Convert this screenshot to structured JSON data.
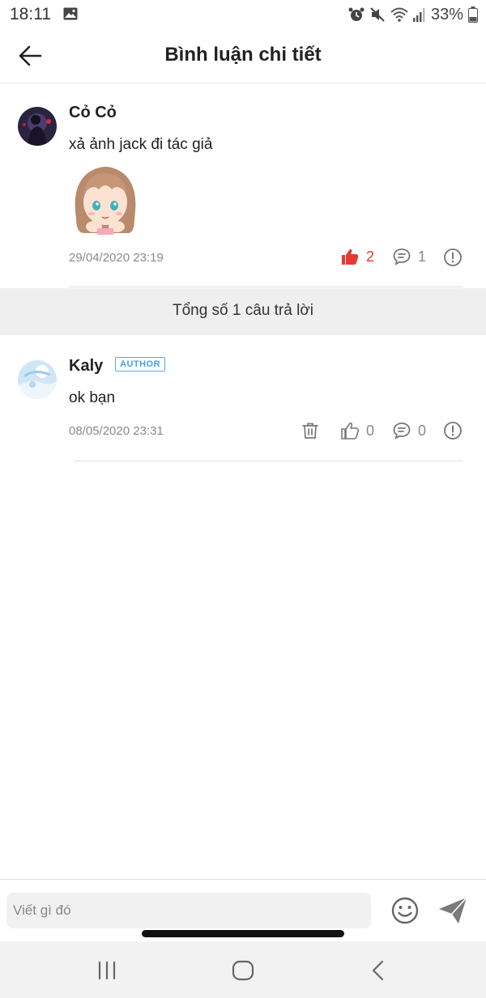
{
  "status_bar": {
    "time": "18:11",
    "battery": "33%",
    "icons": [
      "image-icon",
      "alarm-icon",
      "mute-icon",
      "wifi-icon",
      "signal-icon",
      "battery-icon"
    ]
  },
  "header": {
    "title": "Bình luận chi tiết",
    "back_icon": "arrow-left-icon"
  },
  "main_comment": {
    "username": "Cỏ Cỏ",
    "text": "xả ảnh jack đi tác giả",
    "timestamp": "29/04/2020 23:19",
    "like_count": "2",
    "reply_count": "1",
    "liked": true,
    "like_color": "#e53935"
  },
  "summary": {
    "text": "Tổng số 1 câu trả lời"
  },
  "reply": {
    "username": "Kaly",
    "badge": "AUTHOR",
    "text": "ok bạn",
    "timestamp": "08/05/2020 23:31",
    "like_count": "0",
    "reply_count": "0"
  },
  "input": {
    "placeholder": "Viết gì đó",
    "value": ""
  },
  "colors": {
    "accent_red": "#e53935",
    "badge_blue": "#4a9ee0",
    "icon_gray": "#777777"
  }
}
